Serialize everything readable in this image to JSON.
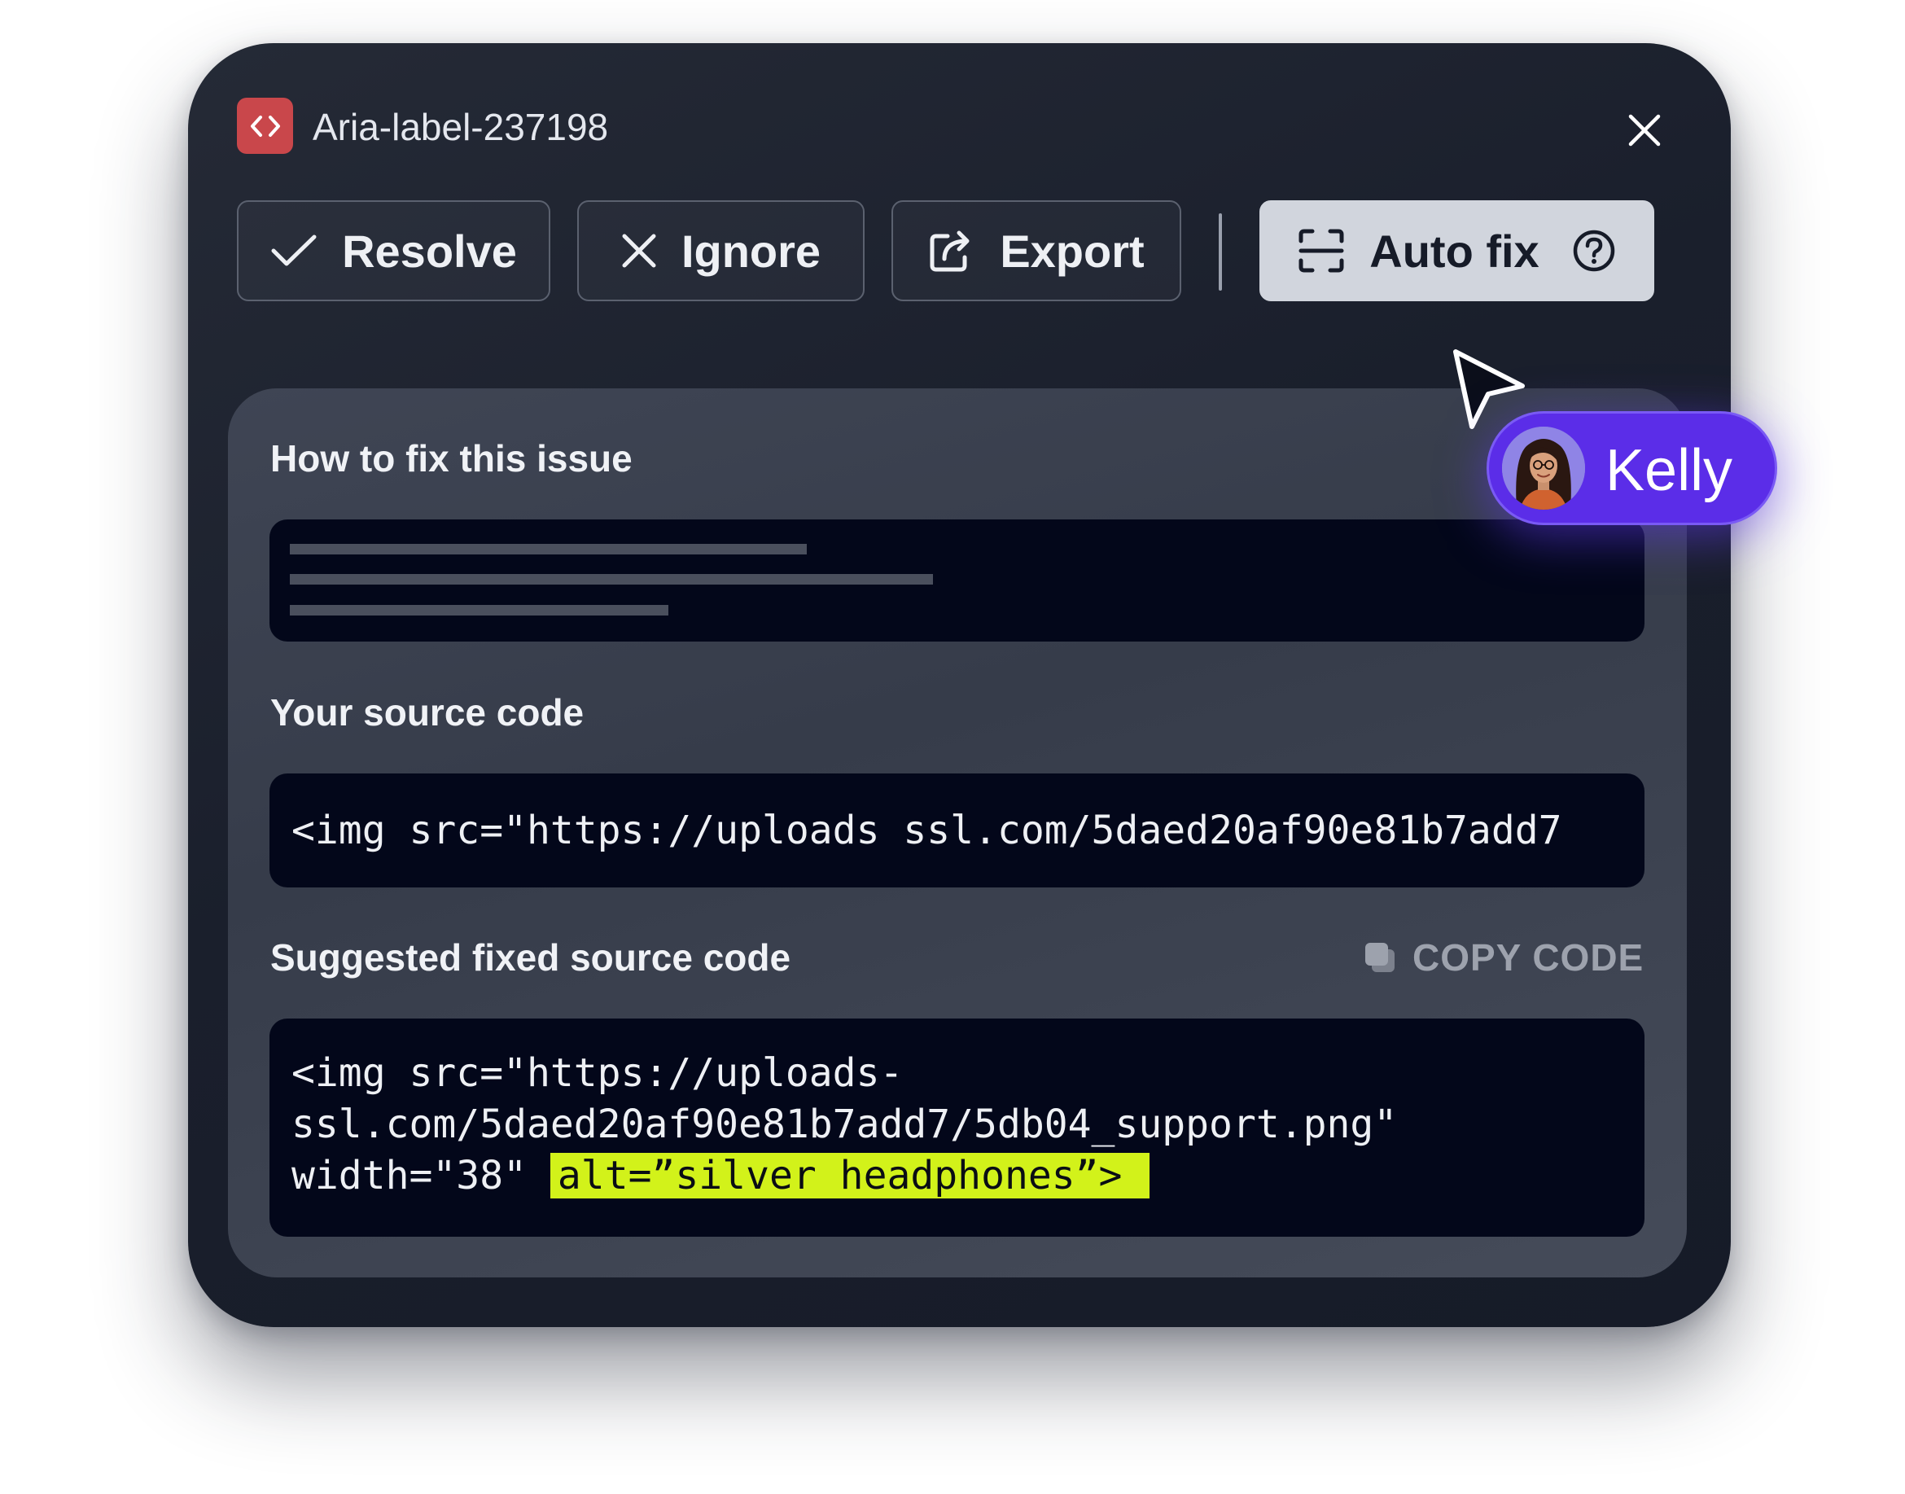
{
  "issue": {
    "icon": "code-brackets-icon",
    "title": "Aria-label-237198"
  },
  "toolbar": {
    "resolve_label": "Resolve",
    "ignore_label": "Ignore",
    "export_label": "Export",
    "autofix_label": "Auto fix"
  },
  "sections": {
    "how_to_fix": "How to fix this issue",
    "source_code": "Your source code",
    "suggested": "Suggested fixed source code",
    "copy_code": "COPY CODE"
  },
  "code": {
    "source": "<img src=\"https://uploads ssl.com/5daed20af90e81b7add7",
    "suggested_line1": "<img src=\"https://uploads-",
    "suggested_line2": "ssl.com/5daed20af90e81b7add7/5db04_support.png\"",
    "suggested_line3": "width=\"38\" ",
    "suggested_highlight": "alt=”silver headphones”>"
  },
  "collaborator": {
    "name": "Kelly",
    "color": "#5b2de8"
  },
  "colors": {
    "accent_highlight": "#d2f21a",
    "issue_icon": "#c9474b",
    "panel": "#1a1f2c"
  }
}
